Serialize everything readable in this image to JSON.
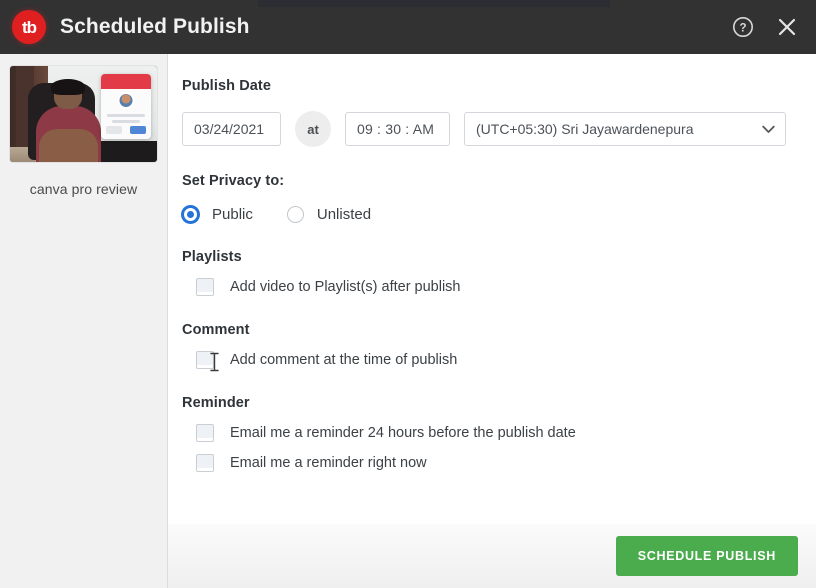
{
  "window": {
    "title": "Scheduled Publish",
    "logo_text": "tb",
    "help_icon": "help-circle-icon",
    "close_icon": "close-icon"
  },
  "sidebar": {
    "video_caption": "canva pro review"
  },
  "form": {
    "publish_date": {
      "label": "Publish Date",
      "date_value": "03/24/2021",
      "separator": "at",
      "time_value": "09 : 30 : AM",
      "timezone_value": "(UTC+05:30) Sri Jayawardenepura",
      "timezone_options": [
        "(UTC+05:30) Sri Jayawardenepura"
      ]
    },
    "privacy": {
      "label": "Set Privacy to:",
      "options": [
        {
          "label": "Public",
          "checked": true
        },
        {
          "label": "Unlisted",
          "checked": false
        }
      ]
    },
    "playlists": {
      "label": "Playlists",
      "items": [
        {
          "label": "Add video to Playlist(s) after publish",
          "checked": false
        }
      ]
    },
    "comment": {
      "label": "Comment",
      "items": [
        {
          "label": "Add comment at the time of publish",
          "checked": false
        }
      ]
    },
    "reminder": {
      "label": "Reminder",
      "items": [
        {
          "label": "Email me a reminder 24 hours before the publish date",
          "checked": false
        },
        {
          "label": "Email me a reminder right now",
          "checked": false
        }
      ]
    }
  },
  "footer": {
    "submit_label": "SCHEDULE PUBLISH"
  },
  "colors": {
    "titlebar": "#323232",
    "brand_red": "#e02020",
    "accent_blue": "#2573d8",
    "primary_green": "#4aac4d",
    "sidebar_bg": "#f1f1f1"
  }
}
